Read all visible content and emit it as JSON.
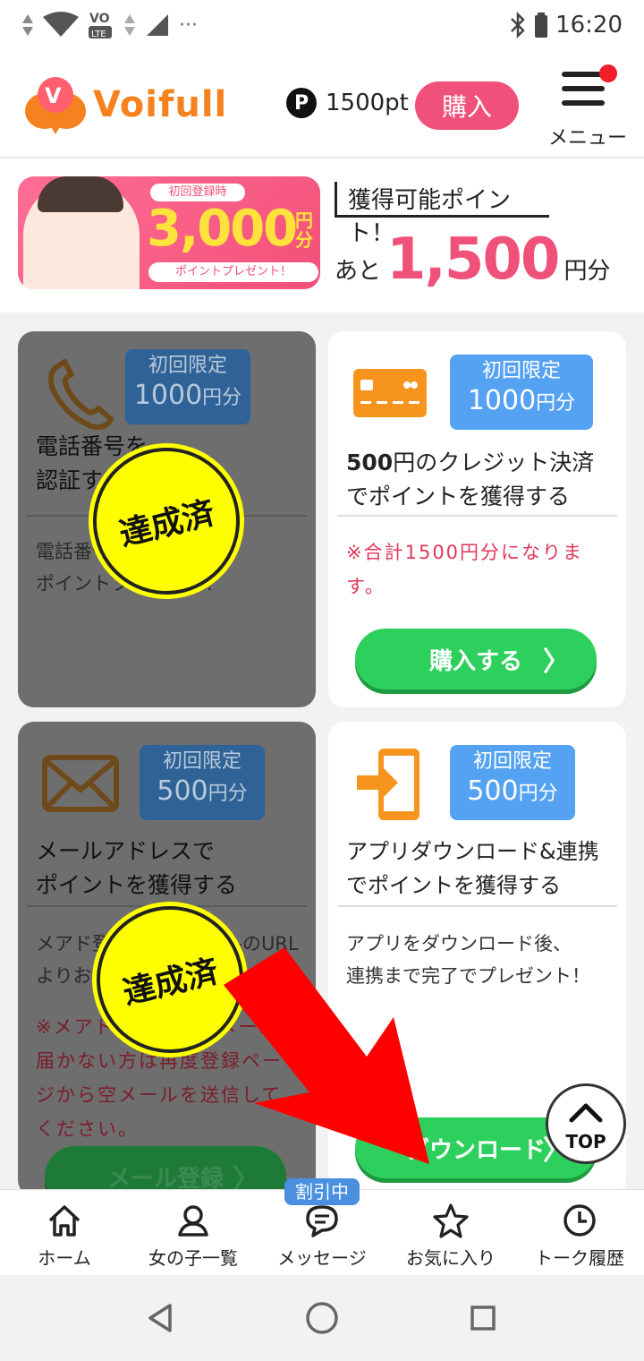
{
  "status": {
    "time": "16:20",
    "dots": "···",
    "volte_top": "VO",
    "volte_bottom": "LTE"
  },
  "header": {
    "brand": "Voifull",
    "points_icon": "P",
    "points": "1500pt",
    "buy_label": "購入",
    "menu_label": "メニュー"
  },
  "promo": {
    "banner_small": "初回登録時",
    "banner_amount": "3,000",
    "banner_unit": "円分",
    "banner_present": "ポイントプレゼント！",
    "headline": "獲得可能ポイント！",
    "remaining_prefix": "あと",
    "remaining_value": "1,500",
    "remaining_unit": "円分"
  },
  "cards": [
    {
      "tag_top": "初回限定",
      "tag_amount": "1000",
      "tag_unit": "円分",
      "title_l1": "電話番号を",
      "title_l2": "認証する",
      "desc_l1": "電話番号認証で",
      "desc_l2": "ポイントプレゼント！",
      "done_label": "達成済"
    },
    {
      "tag_top": "初回限定",
      "tag_amount": "1000",
      "tag_unit": "円分",
      "title_bold": "500",
      "title_l1": "円のクレジット決済",
      "title_l2": "でポイントを獲得する",
      "note": "※合計1500円分になります。",
      "button": "購入する"
    },
    {
      "tag_top": "初回限定",
      "tag_amount": "500",
      "tag_unit": "円分",
      "title_l1": "メールアドレスで",
      "title_l2": "ポイントを獲得する",
      "desc_l1": "メアド登録後確認メールのURL",
      "desc_l2": "よりお手続き",
      "note": "※メアド登録後確認メールが届かない方は再度登録ページから空メールを送信してください。",
      "button": "メール登録",
      "done_label": "達成済"
    },
    {
      "tag_top": "初回限定",
      "tag_amount": "500",
      "tag_unit": "円分",
      "title_l1": "アプリダウンロード&連携",
      "title_l2": "でポイントを獲得する",
      "desc_l1": "アプリをダウンロード後、",
      "desc_l2": "連携まで完了でプレゼント！",
      "button": "ダウンロード"
    }
  ],
  "top_button": "TOP",
  "tabs": [
    {
      "label": "ホーム",
      "icon": "home-icon"
    },
    {
      "label": "女の子一覧",
      "icon": "person-icon"
    },
    {
      "label": "メッセージ",
      "icon": "message-icon"
    },
    {
      "label": "お気に入り",
      "icon": "star-icon"
    },
    {
      "label": "トーク履歴",
      "icon": "clock-icon"
    }
  ],
  "message_badge": "割引中",
  "colors": {
    "brand_orange": "#f6821f",
    "accent_pink": "#f0517a",
    "tag_blue": "#55a2f3",
    "button_green": "#2ed05d",
    "stamp_yellow": "#ffff00",
    "arrow_red": "#ff0000"
  }
}
